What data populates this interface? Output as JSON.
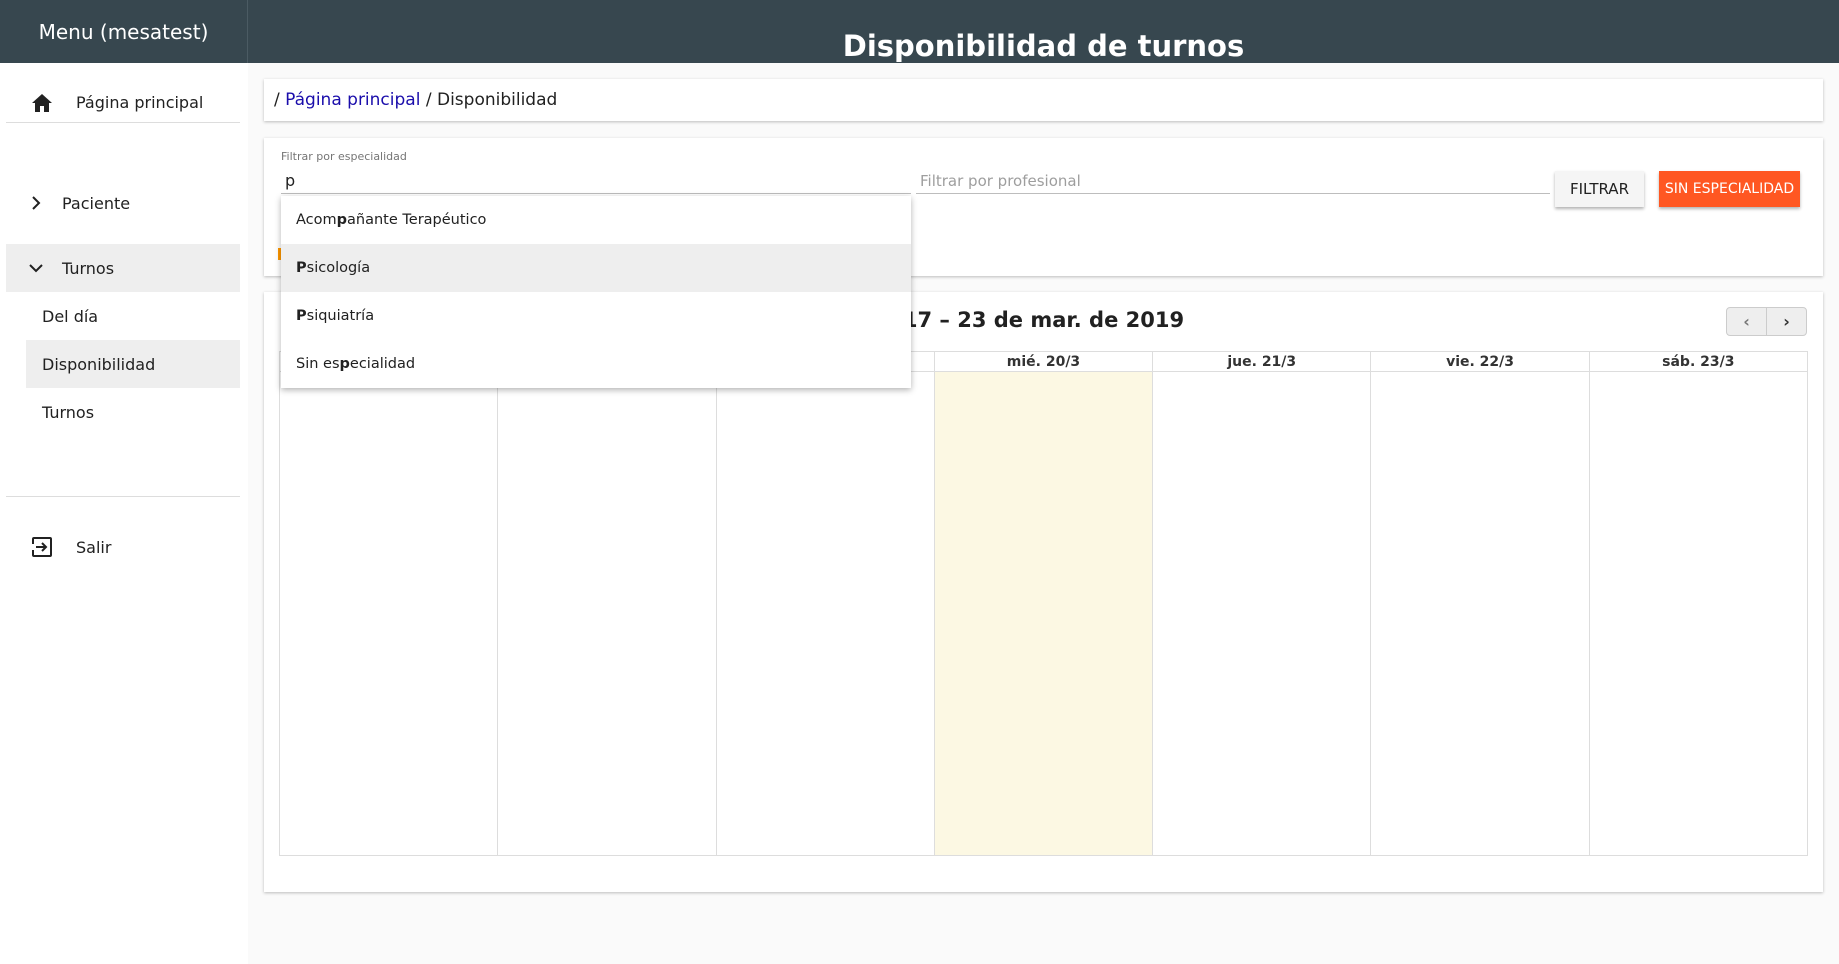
{
  "sidebar": {
    "title": "Menu (mesatest)",
    "home": {
      "label": "Página principal",
      "icon": "home-icon"
    },
    "paciente": {
      "label": "Paciente",
      "icon": "chevron-right-icon"
    },
    "turnos": {
      "label": "Turnos",
      "icon": "chevron-down-icon"
    },
    "sub_items": [
      {
        "label": "Del día"
      },
      {
        "label": "Disponibilidad"
      },
      {
        "label": "Turnos"
      }
    ],
    "salir": {
      "label": "Salir",
      "icon": "logout-icon"
    }
  },
  "header": {
    "title": "Disponibilidad de turnos"
  },
  "breadcrumb": {
    "separator": "/",
    "home_link": "Página principal",
    "current": "Disponibilidad"
  },
  "filters": {
    "specialty_label": "Filtrar por especialidad",
    "specialty_value": "p",
    "professional_placeholder": "Filtrar por profesional",
    "filter_button": "FILTRAR",
    "no_specialty_button": "SIN ESPECIALIDAD"
  },
  "autocomplete": {
    "options": [
      {
        "pre": "Acom",
        "match": "p",
        "post": "añante Terapéutico"
      },
      {
        "pre": "",
        "match": "P",
        "post": "sicología"
      },
      {
        "pre": "",
        "match": "P",
        "post": "siquiatría"
      },
      {
        "pre": "Sin es",
        "match": "p",
        "post": "ecialidad"
      }
    ]
  },
  "calendar": {
    "title": "17 – 23 de mar. de 2019",
    "prev": "‹",
    "next": "›",
    "days": [
      {
        "label": "",
        "today": false
      },
      {
        "label": "",
        "today": false
      },
      {
        "label": "",
        "today": false
      },
      {
        "label": "mié. 20/3",
        "today": true
      },
      {
        "label": "jue. 21/3",
        "today": false
      },
      {
        "label": "vie. 22/3",
        "today": false
      },
      {
        "label": "sáb. 23/3",
        "today": false
      }
    ]
  },
  "colors": {
    "header_bg": "#37474f",
    "accent": "#ff5722",
    "today_bg": "#fcf8e3"
  }
}
